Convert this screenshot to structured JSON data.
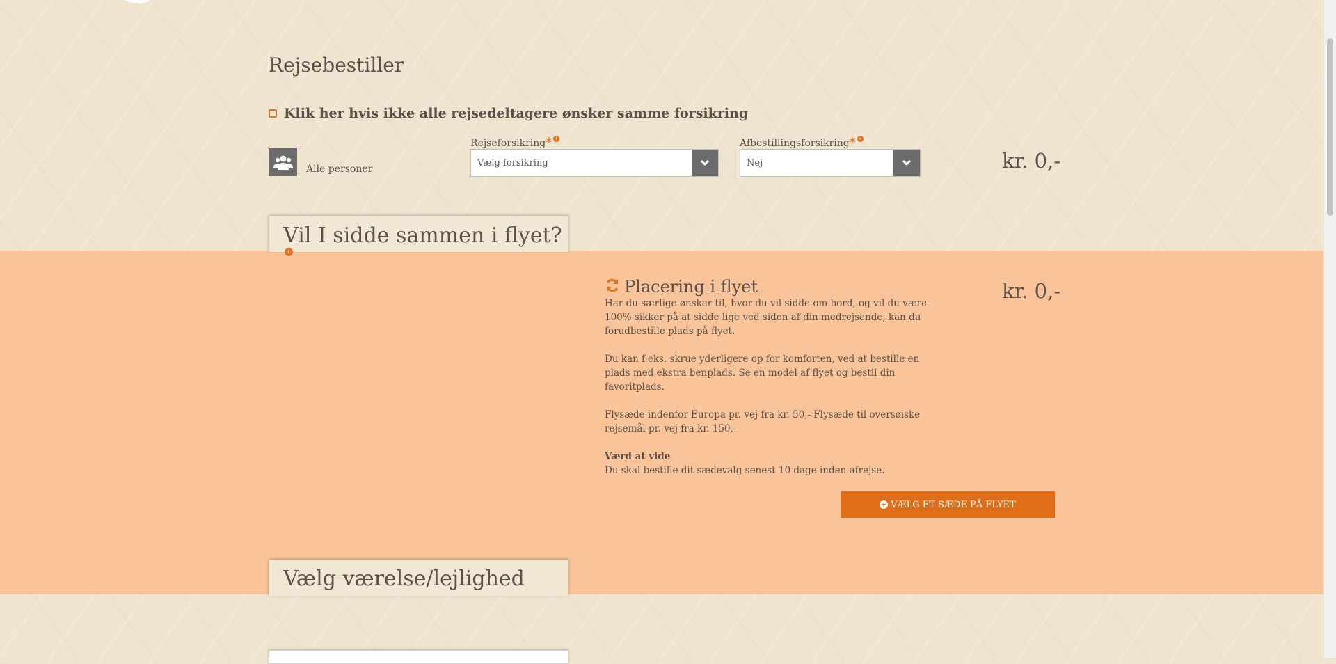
{
  "section": {
    "title": "Rejsebestiller"
  },
  "insurance": {
    "checkbox_label": "Klik her hvis ikke alle rejsedeltagere ønsker samme forsikring",
    "people_label": "Alle personer",
    "travel_label": "Rejseforsikring",
    "travel_value": "Vælg forsikring",
    "cancel_label": "Afbestillingsforsikring",
    "cancel_value": "Nej",
    "required_mark": "*",
    "info_mark": "i",
    "price": "kr. 0,-"
  },
  "seats": {
    "tab_title": "Vil I sidde sammen i flyet?",
    "heading": "Placering i flyet",
    "price": "kr. 0,-",
    "para1": "Har du særlige ønsker til, hvor du vil sidde om bord, og vil du være 100% sikker på at sidde lige ved siden af din medrejsende, kan du forudbestille plads på flyet.",
    "para2": "Du kan f.eks. skrue yderligere op for komforten, ved at bestille en plads med ekstra benplads. Se en model af flyet og bestil din favoritplads.",
    "para3": "Flysæde indenfor Europa pr. vej fra kr. 50,- Flysæde til oversøiske rejsemål pr. vej fra kr. 150,-",
    "note_title": "Værd at vide",
    "note_text": "Du skal bestille dit sædevalg senest 10 dage inden afrejse.",
    "button_label": "VÆLG ET SÆDE PÅ FLYET"
  },
  "room": {
    "tab_title": "Vælg værelse/lejlighed"
  },
  "colors": {
    "accent": "#e06d18",
    "band": "#f9c499",
    "select_arrow_bg": "#6b6b6b"
  },
  "icons": [
    "people-icon",
    "chevron-down-icon",
    "refresh-icon",
    "info-icon",
    "plus-circle-icon"
  ]
}
